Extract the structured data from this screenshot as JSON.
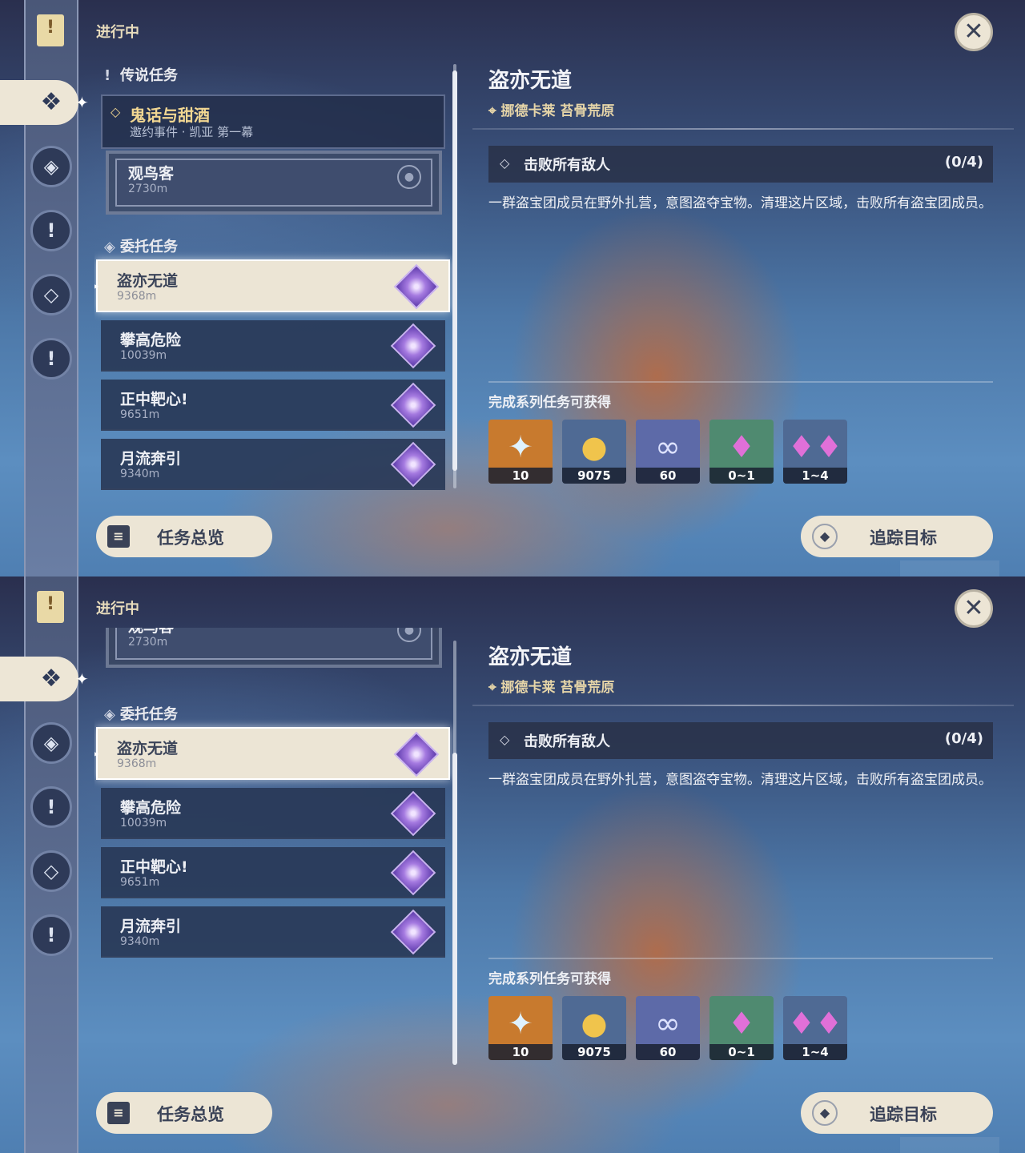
{
  "header": "进行中",
  "close_icon": "✕",
  "sections": {
    "legend": "传说任务",
    "commission": "委托任务"
  },
  "legend_quest": {
    "title": "鬼话与甜酒",
    "subtitle": "邀约事件 · 凯亚 第一幕"
  },
  "sub_quest": {
    "title": "观鸟客",
    "distance": "2730m"
  },
  "quests": [
    {
      "title": "盗亦无道",
      "distance": "9368m"
    },
    {
      "title": "攀高危险",
      "distance": "10039m"
    },
    {
      "title": "正中靶心!",
      "distance": "9651m"
    },
    {
      "title": "月流奔引",
      "distance": "9340m"
    }
  ],
  "detail": {
    "title": "盗亦无道",
    "location": "挪德卡莱 苔骨荒原",
    "objective": "击败所有敌人",
    "progress": "(0/4)",
    "description": "一群盗宝团成员在野外扎营，意图盗夺宝物。清理这片区域，击败所有盗宝团成员。",
    "rewards_label": "完成系列任务可获得",
    "rewards": [
      {
        "icon": "primogem-icon",
        "count": "10",
        "bg": "#c87a2e"
      },
      {
        "icon": "mora-icon",
        "count": "9075",
        "bg": "#4f6a94"
      },
      {
        "icon": "friendship-icon",
        "count": "60",
        "bg": "#5d6aa8"
      },
      {
        "icon": "crystal-small-icon",
        "count": "0~1",
        "bg": "#4f8a70"
      },
      {
        "icon": "crystal-large-icon",
        "count": "1~4",
        "bg": "#4f6a94"
      }
    ]
  },
  "buttons": {
    "overview": "任务总览",
    "track": "追踪目标"
  },
  "colors": {
    "accent_gold": "#f2d792",
    "selected_bg": "#ece5d5",
    "gem": "#a57ae0"
  }
}
